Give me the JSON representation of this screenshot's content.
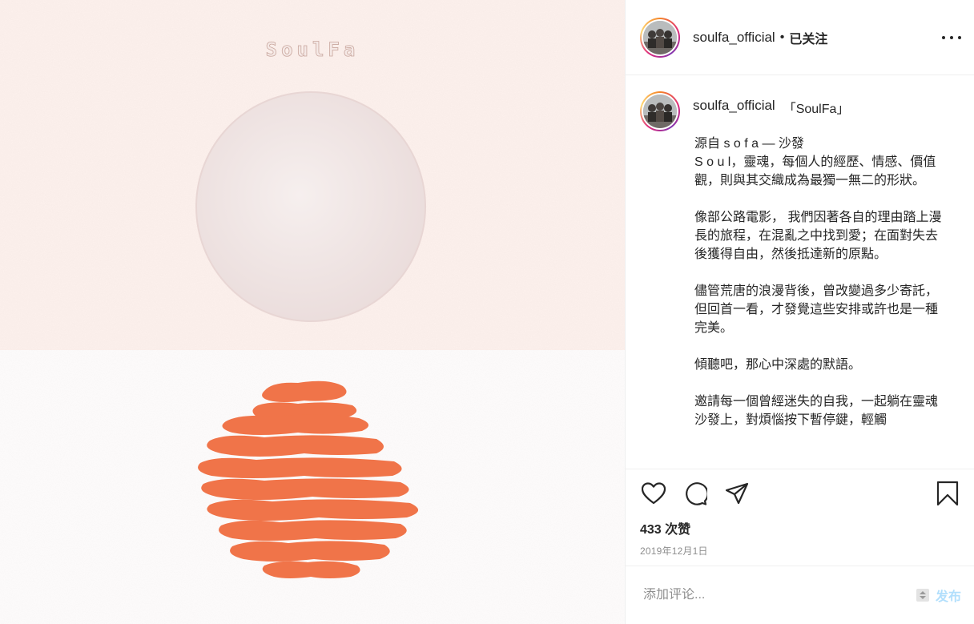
{
  "artwork": {
    "logo_text": "SoulFa",
    "colors": {
      "orange": "#f07449",
      "cream": "#f3e3e0",
      "moon": "#efe5e4"
    }
  },
  "header": {
    "username": "soulfa_official",
    "separator": "•",
    "follow_status": "已关注",
    "more_icon": "more-horizontal-icon"
  },
  "caption": {
    "username": "soulfa_official",
    "title": "「SoulFa」",
    "paragraphs": [
      "源自 s o f a — 沙發\nS o u l，靈魂，每個人的經歷、情感、價值觀，則與其交織成為最獨一無二的形狀。",
      "像部公路電影， 我們因著各自的理由踏上漫長的旅程，在混亂之中找到愛；在面對失去後獲得自由，然後抵達新的原點。",
      "儘管荒唐的浪漫背後，曾改變過多少寄託，但回首一看，才發覺這些安排或許也是一種完美。",
      "傾聽吧，那心中深處的默語。",
      "邀請每一個曾經迷失的自我，一起躺在靈魂沙發上，對煩惱按下暫停鍵，輕觸"
    ]
  },
  "actions": {
    "like_icon": "heart-icon",
    "comment_icon": "comment-icon",
    "share_icon": "share-icon",
    "save_icon": "bookmark-icon"
  },
  "likes": "433 次赞",
  "date": "2019年12月1日",
  "comment": {
    "placeholder": "添加评论...",
    "post_label": "发布",
    "accent": "#b2dffc"
  }
}
